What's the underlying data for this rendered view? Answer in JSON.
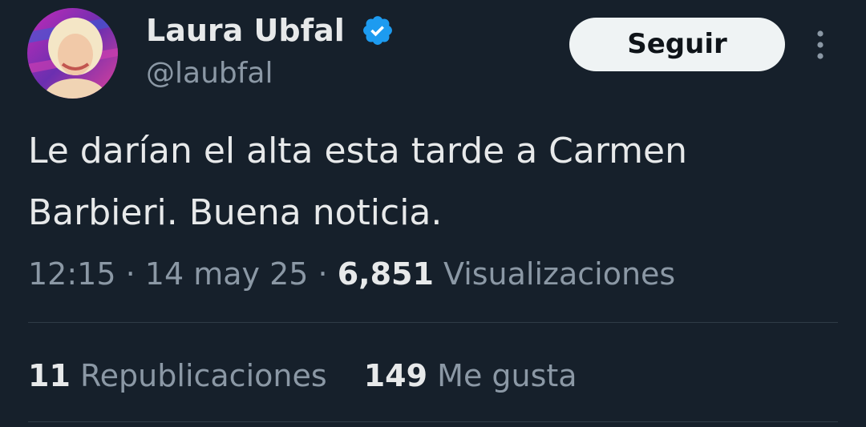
{
  "author": {
    "display_name": "Laura Ubfal",
    "handle": "@laubfal",
    "verified": true,
    "verified_color": "#1d9bf0"
  },
  "follow_button": {
    "label": "Seguir"
  },
  "more_menu": {
    "icon": "more-vertical-icon"
  },
  "tweet": {
    "text": "Le darían el alta esta tarde a Carmen\nBarbieri. Buena noticia.",
    "time": "12:15",
    "separator": "·",
    "date": "14 may 25",
    "views_count": "6,851",
    "views_label": "Visualizaciones"
  },
  "stats": {
    "reposts_count": "11",
    "reposts_label": "Republicaciones",
    "likes_count": "149",
    "likes_label": "Me gusta"
  },
  "colors": {
    "background": "#16202b",
    "text_primary": "#e7e9ea",
    "text_secondary": "#8b98a5",
    "button_bg": "#eff3f4",
    "divider": "#2f3b47"
  }
}
